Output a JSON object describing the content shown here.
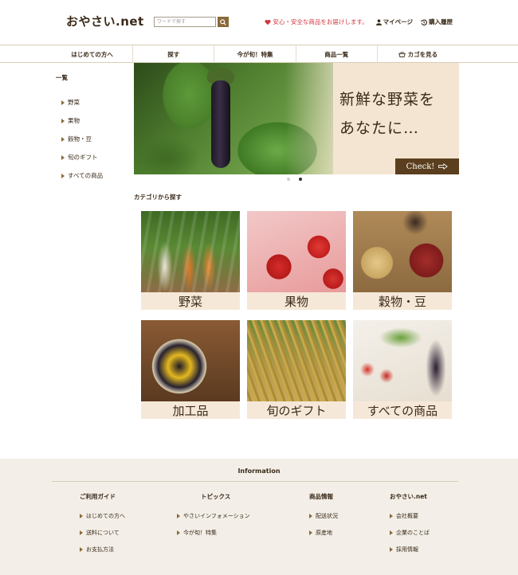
{
  "header": {
    "logo": "おやさい.net",
    "search_placeholder": "ワードで探す",
    "notice": "安心・安全な商品をお届けします。",
    "mypage": "マイページ",
    "history": "購入履歴"
  },
  "nav": {
    "items": [
      {
        "label": "はじめての方へ"
      },
      {
        "label": "探す"
      },
      {
        "label": "今が旬！特集"
      },
      {
        "label": "商品一覧"
      },
      {
        "label": "カゴを見る"
      }
    ]
  },
  "sidebar": {
    "title": "一覧",
    "items": [
      {
        "label": "野菜"
      },
      {
        "label": "果物"
      },
      {
        "label": "穀物・豆"
      },
      {
        "label": "旬のギフト"
      },
      {
        "label": "すべての商品"
      }
    ]
  },
  "hero": {
    "line1": "新鮮な野菜を",
    "line2": "あなたに…",
    "cta": "Check!",
    "slides_total": 2,
    "active_slide": 2
  },
  "categories": {
    "heading": "カテゴリから探す",
    "items": [
      {
        "label": "野菜"
      },
      {
        "label": "果物"
      },
      {
        "label": "穀物・豆"
      },
      {
        "label": "加工品"
      },
      {
        "label": "旬のギフト"
      },
      {
        "label": "すべての商品"
      }
    ]
  },
  "footer": {
    "title": "Information",
    "columns": [
      {
        "title": "ご利用ガイド",
        "links": [
          "はじめての方へ",
          "送料について",
          "お支払方法"
        ]
      },
      {
        "title": "トピックス",
        "links": [
          "やさいインフォメーション",
          "今が旬！特集"
        ]
      },
      {
        "title": "商品情報",
        "links": [
          "配送状況",
          "原産地"
        ]
      },
      {
        "title": "おやさい.net",
        "links": [
          "会社概要",
          "企業のことば",
          "採用情報"
        ]
      }
    ]
  },
  "colors": {
    "brown": "#8a6a3a",
    "dark_brown": "#5a3e1e",
    "notice_red": "#d5343d",
    "label_bg": "#f6e8d8",
    "footer_bg": "#f3efe8"
  }
}
